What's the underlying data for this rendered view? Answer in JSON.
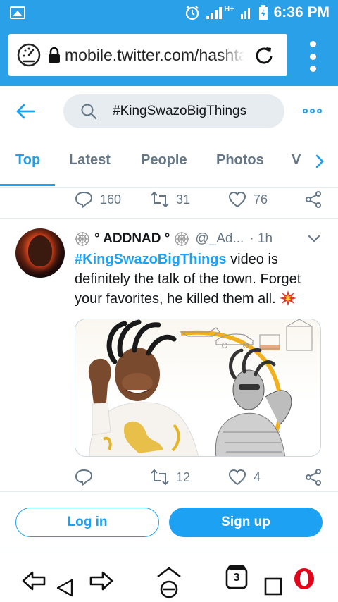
{
  "status_bar": {
    "network_label": "H+",
    "time": "6:36 PM"
  },
  "browser": {
    "url": "mobile.twitter.com/hashtag/KingSwazoBigThings"
  },
  "search": {
    "query": "#KingSwazoBigThings"
  },
  "tabs": [
    {
      "label": "Top",
      "active": true
    },
    {
      "label": "Latest",
      "active": false
    },
    {
      "label": "People",
      "active": false
    },
    {
      "label": "Photos",
      "active": false
    },
    {
      "label": "V",
      "active": false
    }
  ],
  "previous_tweet": {
    "replies": "160",
    "retweets": "31",
    "likes": "76"
  },
  "tweet": {
    "name": "° ADDNAD °",
    "handle": "@_Ad...",
    "time": "· 1h",
    "hashtag": "#KingSwazoBigThings",
    "text": " video is definitely the talk of the town. Forget your favorites, he killed them all. ",
    "retweets": "12",
    "likes": "4"
  },
  "auth": {
    "login_label": "Log in",
    "signup_label": "Sign up"
  },
  "nav": {
    "tabs_count": "3"
  },
  "colors": {
    "twitter_blue": "#1da1f2",
    "status_blue": "#2aa0e8",
    "secondary_text": "#657786"
  }
}
